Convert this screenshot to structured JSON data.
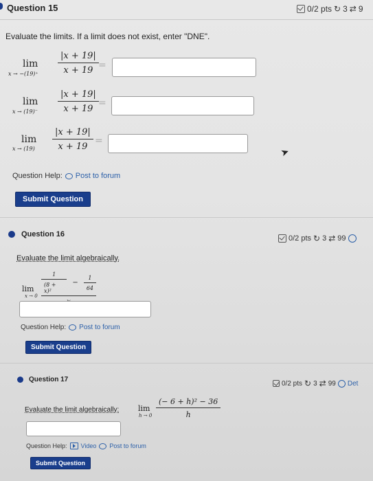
{
  "q15": {
    "title": "Question 15",
    "pts": "0/2 pts",
    "retry": "3",
    "attempts": "9",
    "instruction": "Evaluate the limits. If a limit does not exist, enter \"DNE\".",
    "lim_word": "lim",
    "limits": [
      {
        "sub": "x → −(19)⁺",
        "num": "|x + 19|",
        "den": "x + 19",
        "eq": "="
      },
      {
        "sub": "x → (19)⁻",
        "num": "|x + 19|",
        "den": "x + 19",
        "eq": "="
      },
      {
        "sub": "x → (19)",
        "num": "|x + 19|",
        "den": "x + 19",
        "eq": "="
      }
    ],
    "help_label": "Question Help:",
    "forum": "Post to forum",
    "submit": "Submit Question"
  },
  "q16": {
    "title": "Question 16",
    "pts": "0/2 pts",
    "retry": "3",
    "attempts": "99",
    "instruction": "Evaluate the limit algebraically.",
    "lim_word": "lim",
    "sub": "x → 0",
    "inner_num1": "1",
    "inner_den1": "(8 + x)²",
    "minus": "−",
    "inner_num2": "1",
    "inner_den2": "64",
    "den": "x",
    "help_label": "Question Help:",
    "forum": "Post to forum",
    "submit": "Submit Question"
  },
  "q17": {
    "title": "Question 17",
    "pts": "0/2 pts",
    "retry": "3",
    "attempts": "99",
    "details": "Det",
    "instruction": "Evaluate the limit algebraically:",
    "lim_word": "lim",
    "sub": "h → 0",
    "num": "(− 6 + h)² − 36",
    "den": "h",
    "help_label": "Question Help:",
    "video": "Video",
    "forum": "Post to forum",
    "submit": "Submit Question"
  },
  "colors": {
    "accent": "#1a3e8c",
    "link": "#2b5fa8"
  }
}
